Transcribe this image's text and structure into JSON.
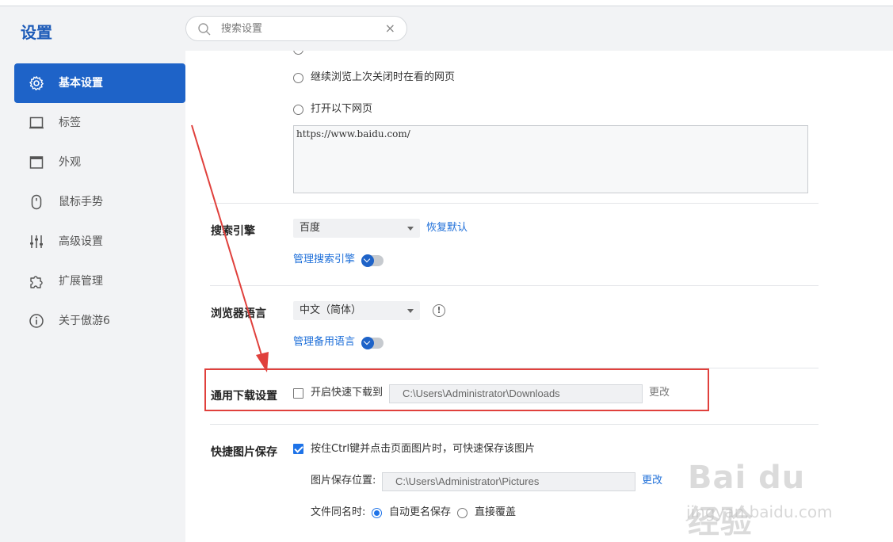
{
  "app": {
    "title": "设置"
  },
  "sidebar": {
    "items": [
      {
        "label": "基本设置",
        "icon": "gear-icon",
        "active": true
      },
      {
        "label": "标签",
        "icon": "tab-icon"
      },
      {
        "label": "外观",
        "icon": "window-icon"
      },
      {
        "label": "鼠标手势",
        "icon": "mouse-icon"
      },
      {
        "label": "高级设置",
        "icon": "sliders-icon"
      },
      {
        "label": "扩展管理",
        "icon": "puzzle-icon"
      },
      {
        "label": "关于傲游6",
        "icon": "info-icon"
      }
    ]
  },
  "search": {
    "placeholder": "搜索设置",
    "clear": "×"
  },
  "startup": {
    "option_continue": "继续浏览上次关闭时在看的网页",
    "option_open_pages": "打开以下网页",
    "urls": "https://www.baidu.com/"
  },
  "search_engine": {
    "title": "搜索引擎",
    "selected": "百度",
    "restore_label": "恢复默认",
    "manage_label": "管理搜索引擎"
  },
  "language": {
    "title": "浏览器语言",
    "selected": "中文（简体）",
    "info": "!",
    "manage_label": "管理备用语言"
  },
  "download": {
    "title": "通用下载设置",
    "checkbox_label": "开启快速下载到",
    "checked": false,
    "path": "C:\\Users\\Administrator\\Downloads",
    "change_label": "更改"
  },
  "image_save": {
    "title": "快捷图片保存",
    "checkbox_label": "按住Ctrl键并点击页面图片时，可快速保存该图片",
    "checked": true,
    "location_label": "图片保存位置:",
    "path": "C:\\Users\\Administrator\\Pictures",
    "change_label": "更改",
    "same_name_label": "文件同名时:",
    "option_rename": "自动更名保存",
    "option_overwrite": "直接覆盖"
  },
  "watermark": {
    "logo": "Bai du 经验",
    "sub": "jingyan.baidu.com"
  },
  "colors": {
    "accent": "#1e63c8",
    "link": "#1e6fd9",
    "annotation": "#e0403c"
  }
}
